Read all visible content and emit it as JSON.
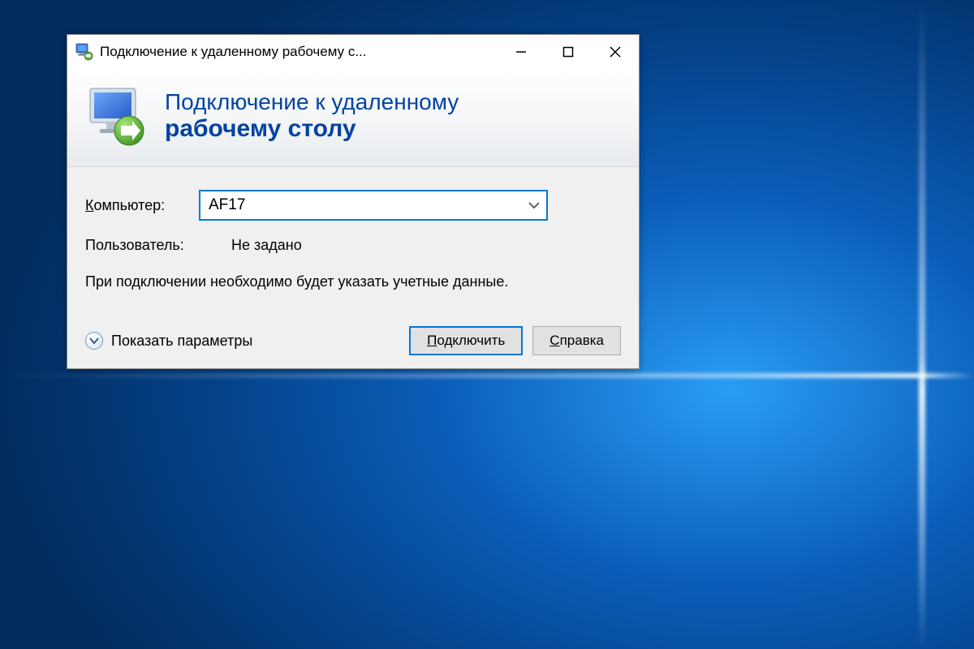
{
  "window": {
    "title": "Подключение к удаленному рабочему с..."
  },
  "header": {
    "line1": "Подключение к удаленному",
    "line2": "рабочему столу"
  },
  "form": {
    "computer_label_prefix": "К",
    "computer_label_rest": "омпьютер:",
    "computer_value": "AF17",
    "user_label": "Пользователь:",
    "user_value": "Не задано",
    "info_text": "При подключении необходимо будет указать учетные данные."
  },
  "footer": {
    "expand_prefix": "П",
    "expand_rest": "оказать параметры",
    "connect_prefix": "П",
    "connect_rest": "одключить",
    "help_prefix": "С",
    "help_rest": "правка"
  }
}
